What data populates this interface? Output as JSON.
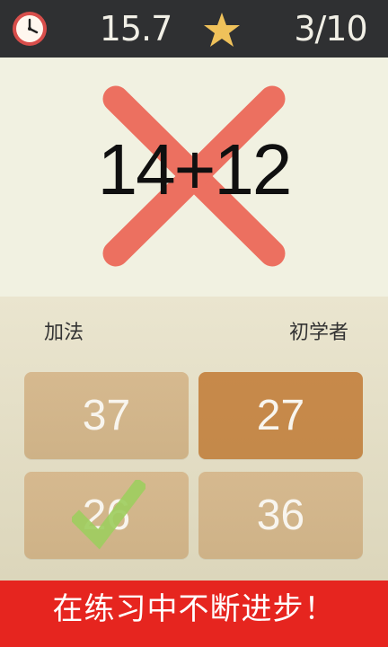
{
  "topbar": {
    "clock_icon": "clock-icon",
    "timer": "15.7",
    "star_icon": "star-icon",
    "progress": "3/10"
  },
  "question": {
    "text": "14+12",
    "result_mark": "wrong-x-icon",
    "mark_color": "#ec7060"
  },
  "labels": {
    "mode": "加法",
    "level": "初学者"
  },
  "answers": [
    {
      "value": "37",
      "state": "default"
    },
    {
      "value": "27",
      "state": "selected"
    },
    {
      "value": "26",
      "state": "correct",
      "mark": "check-icon"
    },
    {
      "value": "36",
      "state": "default"
    }
  ],
  "banner": {
    "text": "在练习中不断进步！",
    "color": "#e6251f"
  },
  "colors": {
    "topbar": "#2f3032",
    "accent_star": "#efc15a",
    "answer_default": "#d6b98f",
    "answer_selected": "#c7894a",
    "check": "#9ecd5f"
  }
}
